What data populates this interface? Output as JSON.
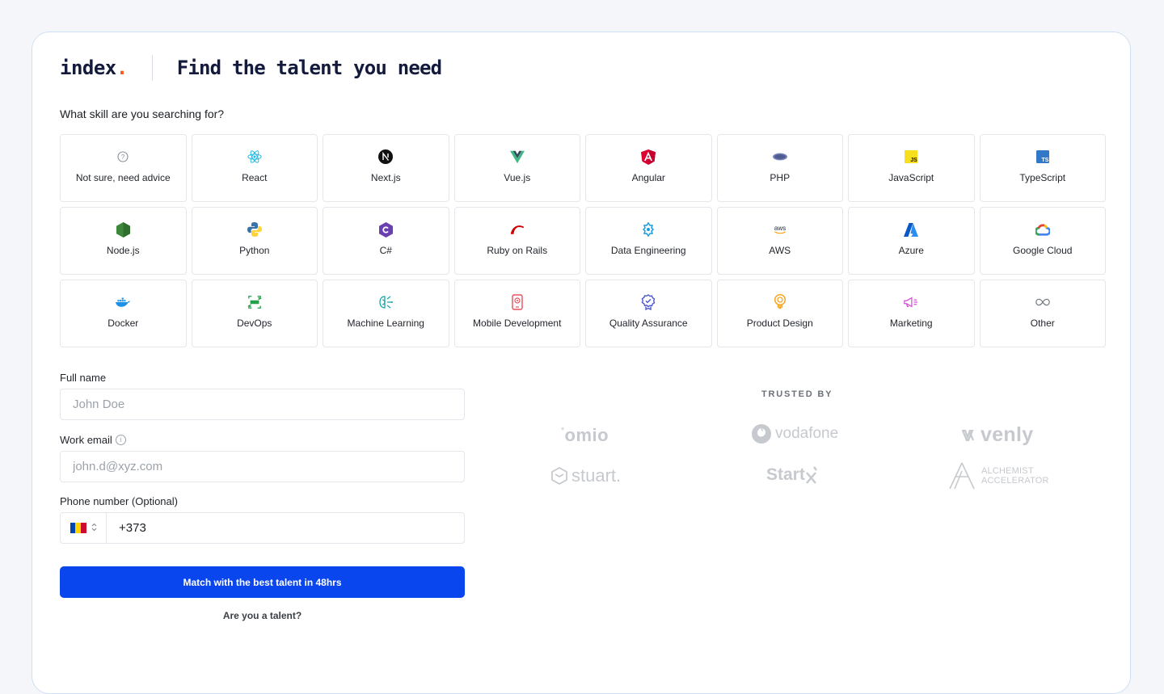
{
  "brand": {
    "name": "index",
    "dot": "."
  },
  "header": {
    "title": "Find the talent you need"
  },
  "skills": {
    "question": "What skill are you searching for?",
    "items": [
      {
        "label": "Not sure, need advice",
        "icon": "question-circle-icon"
      },
      {
        "label": "React",
        "icon": "react-icon"
      },
      {
        "label": "Next.js",
        "icon": "nextjs-icon"
      },
      {
        "label": "Vue.js",
        "icon": "vue-icon"
      },
      {
        "label": "Angular",
        "icon": "angular-icon"
      },
      {
        "label": "PHP",
        "icon": "php-icon"
      },
      {
        "label": "JavaScript",
        "icon": "javascript-icon"
      },
      {
        "label": "TypeScript",
        "icon": "typescript-icon"
      },
      {
        "label": "Node.js",
        "icon": "nodejs-icon"
      },
      {
        "label": "Python",
        "icon": "python-icon"
      },
      {
        "label": "C#",
        "icon": "csharp-icon"
      },
      {
        "label": "Ruby on Rails",
        "icon": "rails-icon"
      },
      {
        "label": "Data Engineering",
        "icon": "data-engineering-icon"
      },
      {
        "label": "AWS",
        "icon": "aws-icon"
      },
      {
        "label": "Azure",
        "icon": "azure-icon"
      },
      {
        "label": "Google Cloud",
        "icon": "google-cloud-icon"
      },
      {
        "label": "Docker",
        "icon": "docker-icon"
      },
      {
        "label": "DevOps",
        "icon": "devops-icon"
      },
      {
        "label": "Machine Learning",
        "icon": "machine-learning-icon"
      },
      {
        "label": "Mobile Development",
        "icon": "mobile-icon"
      },
      {
        "label": "Quality Assurance",
        "icon": "quality-badge-icon"
      },
      {
        "label": "Product Design",
        "icon": "lightbulb-icon"
      },
      {
        "label": "Marketing",
        "icon": "megaphone-icon"
      },
      {
        "label": "Other",
        "icon": "infinity-icon"
      }
    ]
  },
  "form": {
    "full_name": {
      "label": "Full name",
      "placeholder": "John Doe"
    },
    "work_email": {
      "label": "Work email",
      "placeholder": "john.d@xyz.com",
      "info_glyph": "i"
    },
    "phone": {
      "label": "Phone number (Optional)",
      "value": "+373",
      "flag": "moldova-flag-icon"
    },
    "submit_label": "Match with the best talent in 48hrs",
    "talent_link": "Are you a talent?"
  },
  "trusted": {
    "heading": "TRUSTED BY",
    "logos": [
      "omio",
      "vodafone",
      "venly",
      "stuart.",
      "Start",
      "ALCHEMIST",
      "ACCELERATOR"
    ]
  },
  "colors": {
    "accent": "#0a46ee",
    "brand_dot": "#ff5a1f",
    "heading": "#141a3c"
  }
}
